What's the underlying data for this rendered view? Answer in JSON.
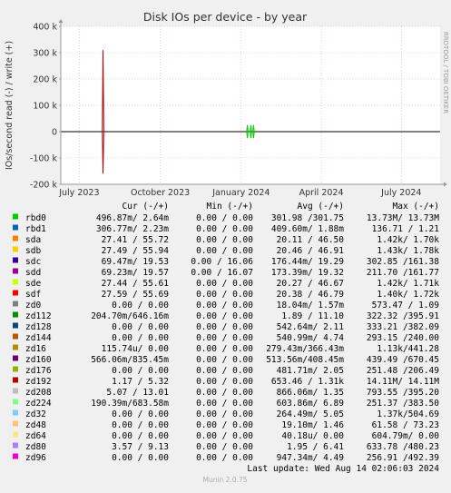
{
  "chart_data": {
    "type": "line",
    "title": "Disk IOs per device - by year",
    "ylabel": "IOs/second read (-) / write (+)",
    "watermark": "RRDTOOL / TOBI OETIKER",
    "footer": "Munin 2.0.75",
    "last_update": "Last update:  Wed Aug 14 02:06:03 2024",
    "ylim": [
      -200000,
      400000
    ],
    "y_ticks": [
      {
        "value": 400000,
        "label": "400 k"
      },
      {
        "value": 300000,
        "label": "300 k"
      },
      {
        "value": 200000,
        "label": "200 k"
      },
      {
        "value": 100000,
        "label": "100 k"
      },
      {
        "value": 0,
        "label": "0"
      },
      {
        "value": -100000,
        "label": "-100 k"
      },
      {
        "value": -200000,
        "label": "-200 k"
      }
    ],
    "xlim": [
      "2023-06-10",
      "2024-08-14"
    ],
    "x_ticks": [
      {
        "date": "2023-07-01",
        "label": "July 2023"
      },
      {
        "date": "2023-10-01",
        "label": "October 2023"
      },
      {
        "date": "2024-01-01",
        "label": "January 2024"
      },
      {
        "date": "2024-04-01",
        "label": "April 2024"
      },
      {
        "date": "2024-07-01",
        "label": "July 2024"
      }
    ],
    "grid": true,
    "legend_headers": {
      "cur": "Cur (-/+)",
      "min": "Min (-/+)",
      "avg": "Avg (-/+)",
      "max": "Max (-/+)"
    },
    "series": [
      {
        "name": "rbd0",
        "color": "#00cc00",
        "cur": "496.87m/  2.64m",
        "min": "0.00 /  0.00",
        "avg": "301.98 /301.75",
        "max": "13.73M/ 13.73M"
      },
      {
        "name": "rbd1",
        "color": "#0066b3",
        "cur": "306.77m/  2.23m",
        "min": "0.00 /  0.00",
        "avg": "409.60m/  1.88m",
        "max": "136.71 /  1.21"
      },
      {
        "name": "sda",
        "color": "#ff8000",
        "cur": "27.41 / 55.72",
        "min": "0.00 /  0.00",
        "avg": "20.11 / 46.50",
        "max": "1.42k/  1.70k"
      },
      {
        "name": "sdb",
        "color": "#ffcc00",
        "cur": "27.49 / 55.94",
        "min": "0.00 /  0.00",
        "avg": "20.46 / 46.91",
        "max": "1.43k/  1.78k"
      },
      {
        "name": "sdc",
        "color": "#330099",
        "cur": "69.47m/ 19.53",
        "min": "0.00 / 16.06",
        "avg": "176.44m/ 19.29",
        "max": "302.85 /161.38"
      },
      {
        "name": "sdd",
        "color": "#990099",
        "cur": "69.23m/ 19.57",
        "min": "0.00 / 16.07",
        "avg": "173.39m/ 19.32",
        "max": "211.70 /161.77"
      },
      {
        "name": "sde",
        "color": "#ccff00",
        "cur": "27.44 / 55.61",
        "min": "0.00 /  0.00",
        "avg": "20.27 / 46.67",
        "max": "1.42k/  1.71k"
      },
      {
        "name": "sdf",
        "color": "#ff0000",
        "cur": "27.59 / 55.69",
        "min": "0.00 /  0.00",
        "avg": "20.38 / 46.79",
        "max": "1.40k/  1.72k"
      },
      {
        "name": "zd0",
        "color": "#808080",
        "cur": "0.00 /  0.00",
        "min": "0.00 /  0.00",
        "avg": "18.04m/  1.57m",
        "max": "573.47 /  1.09"
      },
      {
        "name": "zd112",
        "color": "#008f00",
        "cur": "204.70m/646.16m",
        "min": "0.00 /  0.00",
        "avg": "1.89 / 11.10",
        "max": "322.32 /395.91"
      },
      {
        "name": "zd128",
        "color": "#00487d",
        "cur": "0.00 /  0.00",
        "min": "0.00 /  0.00",
        "avg": "542.64m/  2.11",
        "max": "333.21 /382.09"
      },
      {
        "name": "zd144",
        "color": "#b35a00",
        "cur": "0.00 /  0.00",
        "min": "0.00 /  0.00",
        "avg": "540.99m/  4.74",
        "max": "293.15 /240.00"
      },
      {
        "name": "zd16",
        "color": "#b38f00",
        "cur": "115.74u/  0.00",
        "min": "0.00 /  0.00",
        "avg": "279.43m/366.43m",
        "max": "1.13k/441.28"
      },
      {
        "name": "zd160",
        "color": "#6b006b",
        "cur": "566.06m/835.45m",
        "min": "0.00 /  0.00",
        "avg": "513.56m/408.45m",
        "max": "439.49 /670.45"
      },
      {
        "name": "zd176",
        "color": "#8fb300",
        "cur": "0.00 /  0.00",
        "min": "0.00 /  0.00",
        "avg": "481.71m/  2.05",
        "max": "251.48 /206.49"
      },
      {
        "name": "zd192",
        "color": "#b30000",
        "cur": "1.17 /  5.32",
        "min": "0.00 /  0.00",
        "avg": "653.46 /  1.31k",
        "max": "14.11M/ 14.11M"
      },
      {
        "name": "zd208",
        "color": "#bebebe",
        "cur": "5.07 / 13.01",
        "min": "0.00 /  0.00",
        "avg": "866.06m/  1.35",
        "max": "793.55 /395.20"
      },
      {
        "name": "zd224",
        "color": "#80ff80",
        "cur": "190.39m/683.58m",
        "min": "0.00 /  0.00",
        "avg": "603.86m/  6.89",
        "max": "251.37 /383.50"
      },
      {
        "name": "zd32",
        "color": "#80c9ff",
        "cur": "0.00 /  0.00",
        "min": "0.00 /  0.00",
        "avg": "264.49m/  5.05",
        "max": "1.37k/504.69"
      },
      {
        "name": "zd48",
        "color": "#ffc080",
        "cur": "0.00 /  0.00",
        "min": "0.00 /  0.00",
        "avg": "19.10m/  1.46",
        "max": "61.58 / 73.23"
      },
      {
        "name": "zd64",
        "color": "#ffe680",
        "cur": "0.00 /  0.00",
        "min": "0.00 /  0.00",
        "avg": "40.18u/  0.00",
        "max": "604.79m/  0.00"
      },
      {
        "name": "zd80",
        "color": "#aa80ff",
        "cur": "3.57 /  9.13",
        "min": "0.00 /  0.00",
        "avg": "1.95 /  6.41",
        "max": "633.78 /480.23"
      },
      {
        "name": "zd96",
        "color": "#ee00cc",
        "cur": "0.00 /  0.00",
        "min": "0.00 /  0.00",
        "avg": "947.34m/  4.49",
        "max": "256.91 /492.39"
      }
    ],
    "spikes": [
      {
        "series": "zd192",
        "date": "2023-07-28",
        "read": 160000,
        "write": 310000
      },
      {
        "series": "rbd0",
        "date": "2024-01-08",
        "read": 25000,
        "write": 25000
      },
      {
        "series": "rbd0",
        "date": "2024-01-12",
        "read": 25000,
        "write": 25000
      },
      {
        "series": "rbd0",
        "date": "2024-01-15",
        "read": 25000,
        "write": 25000
      }
    ]
  }
}
